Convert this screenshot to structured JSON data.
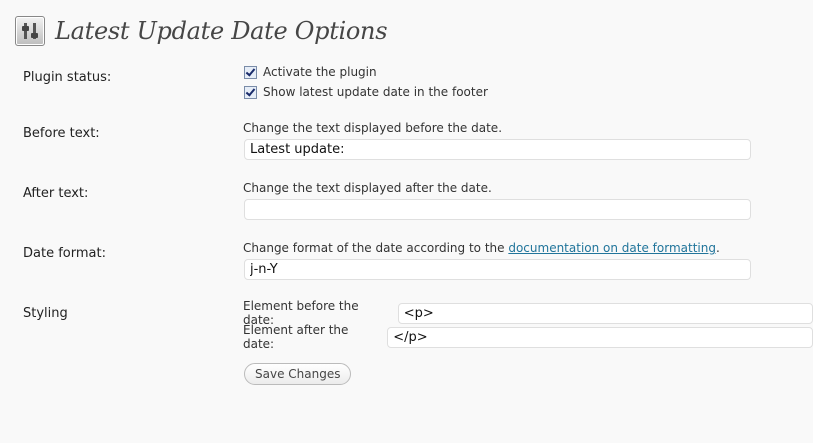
{
  "page": {
    "title": "Latest Update Date Options",
    "icon": "settings-sliders-icon"
  },
  "plugin_status": {
    "label": "Plugin status:",
    "options": [
      {
        "label": "Activate the plugin",
        "checked": true
      },
      {
        "label": "Show latest update date in the footer",
        "checked": true
      }
    ]
  },
  "before_text": {
    "label": "Before text:",
    "description": "Change the text displayed before the date.",
    "value": "Latest update:"
  },
  "after_text": {
    "label": "After text:",
    "description": "Change the text displayed after the date.",
    "value": ""
  },
  "date_format": {
    "label": "Date format:",
    "description_prefix": "Change format of the date according to the ",
    "description_link": "documentation on date formatting",
    "description_suffix": ".",
    "value": "j-n-Y"
  },
  "styling": {
    "label": "Styling",
    "before_label": "Element before the date:",
    "before_value": "<p>",
    "after_label": "Element after the date:",
    "after_value": "</p>"
  },
  "save_button": {
    "label": "Save Changes"
  },
  "colors": {
    "background": "#f9f9f9",
    "link": "#21759b",
    "title": "#464646"
  }
}
